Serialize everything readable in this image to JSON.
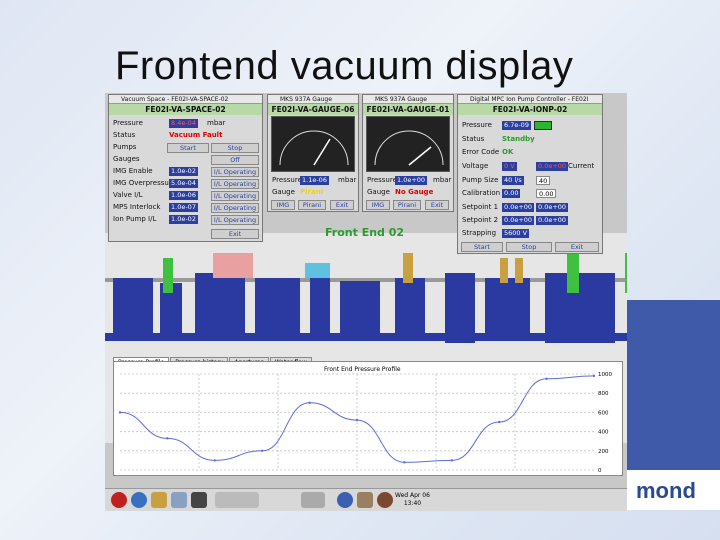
{
  "slide": {
    "title": "Frontend vacuum display",
    "brand": "mond"
  },
  "space_panel": {
    "window_title": "Vacuum Space - FE02I-VA-SPACE-02",
    "header": "FE02I-VA-SPACE-02",
    "rows": [
      {
        "label": "Pressure",
        "value": "8.4e-04",
        "unit": "mbar"
      },
      {
        "label": "Status",
        "value": "Vacuum Fault"
      },
      {
        "label": "Pumps",
        "start": "Start",
        "stop": "Stop"
      },
      {
        "label": "Gauges",
        "value": "Off"
      },
      {
        "label": "IMG Enable",
        "value": "1.0e-02",
        "state": "I/L Operating"
      },
      {
        "label": "IMG Overpressure",
        "value": "5.0e-04",
        "state": "I/L Operating"
      },
      {
        "label": "Valve I/L",
        "value": "1.0e-06",
        "state": "I/L Operating"
      },
      {
        "label": "MPS Interlock",
        "value": "1.0e-07",
        "state": "I/L Operating"
      },
      {
        "label": "Ion Pump I/L",
        "value": "1.0e-02",
        "state": "I/L Operating"
      }
    ],
    "exit": "Exit"
  },
  "gauge6": {
    "window_title": "MKS 937A Gauge",
    "header": "FE02I-VA-GAUGE-06",
    "pressure_label": "Pressure",
    "pressure": "1.1e-06",
    "unit": "mbar",
    "gauge_label": "Gauge",
    "gauge_value": "Pirani",
    "btn_img": "IMG",
    "btn_pirani": "Pirani",
    "btn_exit": "Exit",
    "scale": [
      "-5",
      "-3",
      "-1",
      "-7",
      "-9",
      "-11",
      "-3"
    ]
  },
  "gauge1": {
    "window_title": "MKS 937A Gauge",
    "header": "FE02I-VA-GAUGE-01",
    "pressure_label": "Pressure",
    "pressure": "1.0e+00",
    "unit": "mbar",
    "gauge_label": "Gauge",
    "gauge_value": "No Gauge",
    "btn_img": "IMG",
    "btn_pirani": "Pirani",
    "btn_exit": "Exit",
    "scale": [
      "-5",
      "-3",
      "-1",
      "-7",
      "-9",
      "-11",
      "-3"
    ]
  },
  "ionpump": {
    "window_title": "Digital MPC Ion Pump Controller - FE02I",
    "header": "FE02I-VA-IONP-02",
    "pressure_label": "Pressure",
    "pressure": "6.7e-09",
    "status_label": "Status",
    "status": "Standby",
    "error_label": "Error Code",
    "error": "OK",
    "voltage_label": "Voltage",
    "voltage": "0 V",
    "current": "0.0e+00",
    "current_label": "Current",
    "pumpsize_label": "Pump Size",
    "pumpsize": "40 l/s",
    "pumpsize2": "40",
    "calibration_label": "Calibration",
    "calibration": "0.00",
    "calibration2": "0.00",
    "sp1_label": "Setpoint 1",
    "sp1": "0.0e+00",
    "sp1b": "0.0e+00",
    "sp2_label": "Setpoint 2",
    "sp2": "0.0e+00",
    "sp2b": "0.0e+00",
    "strap_label": "Strapping",
    "strap": "5600 V",
    "start": "Start",
    "stop": "Stop",
    "exit": "Exit"
  },
  "synoptic": {
    "title": "Front End 02"
  },
  "tabs": [
    "Pressure Profile",
    "Pressure history",
    "Apertures",
    "Water flow"
  ],
  "chart_data": {
    "type": "line",
    "title": "Front End Pressure Profile",
    "y_ticks": [
      "1000",
      "800",
      "600",
      "400",
      "200",
      "0"
    ],
    "ylim": [
      0,
      1000
    ],
    "x": [
      0,
      1,
      2,
      3,
      4,
      5,
      6,
      7,
      8,
      9,
      10
    ],
    "values": [
      600,
      330,
      100,
      200,
      700,
      520,
      80,
      100,
      500,
      950,
      980
    ]
  },
  "clock": {
    "line1": "Wed Apr 06",
    "line2": "13:40"
  },
  "colors": {
    "panel_green": "#b6d9a6",
    "value_blue": "#2a3fa0",
    "fault_red": "#dd0000",
    "line": "#5b6dd6"
  }
}
